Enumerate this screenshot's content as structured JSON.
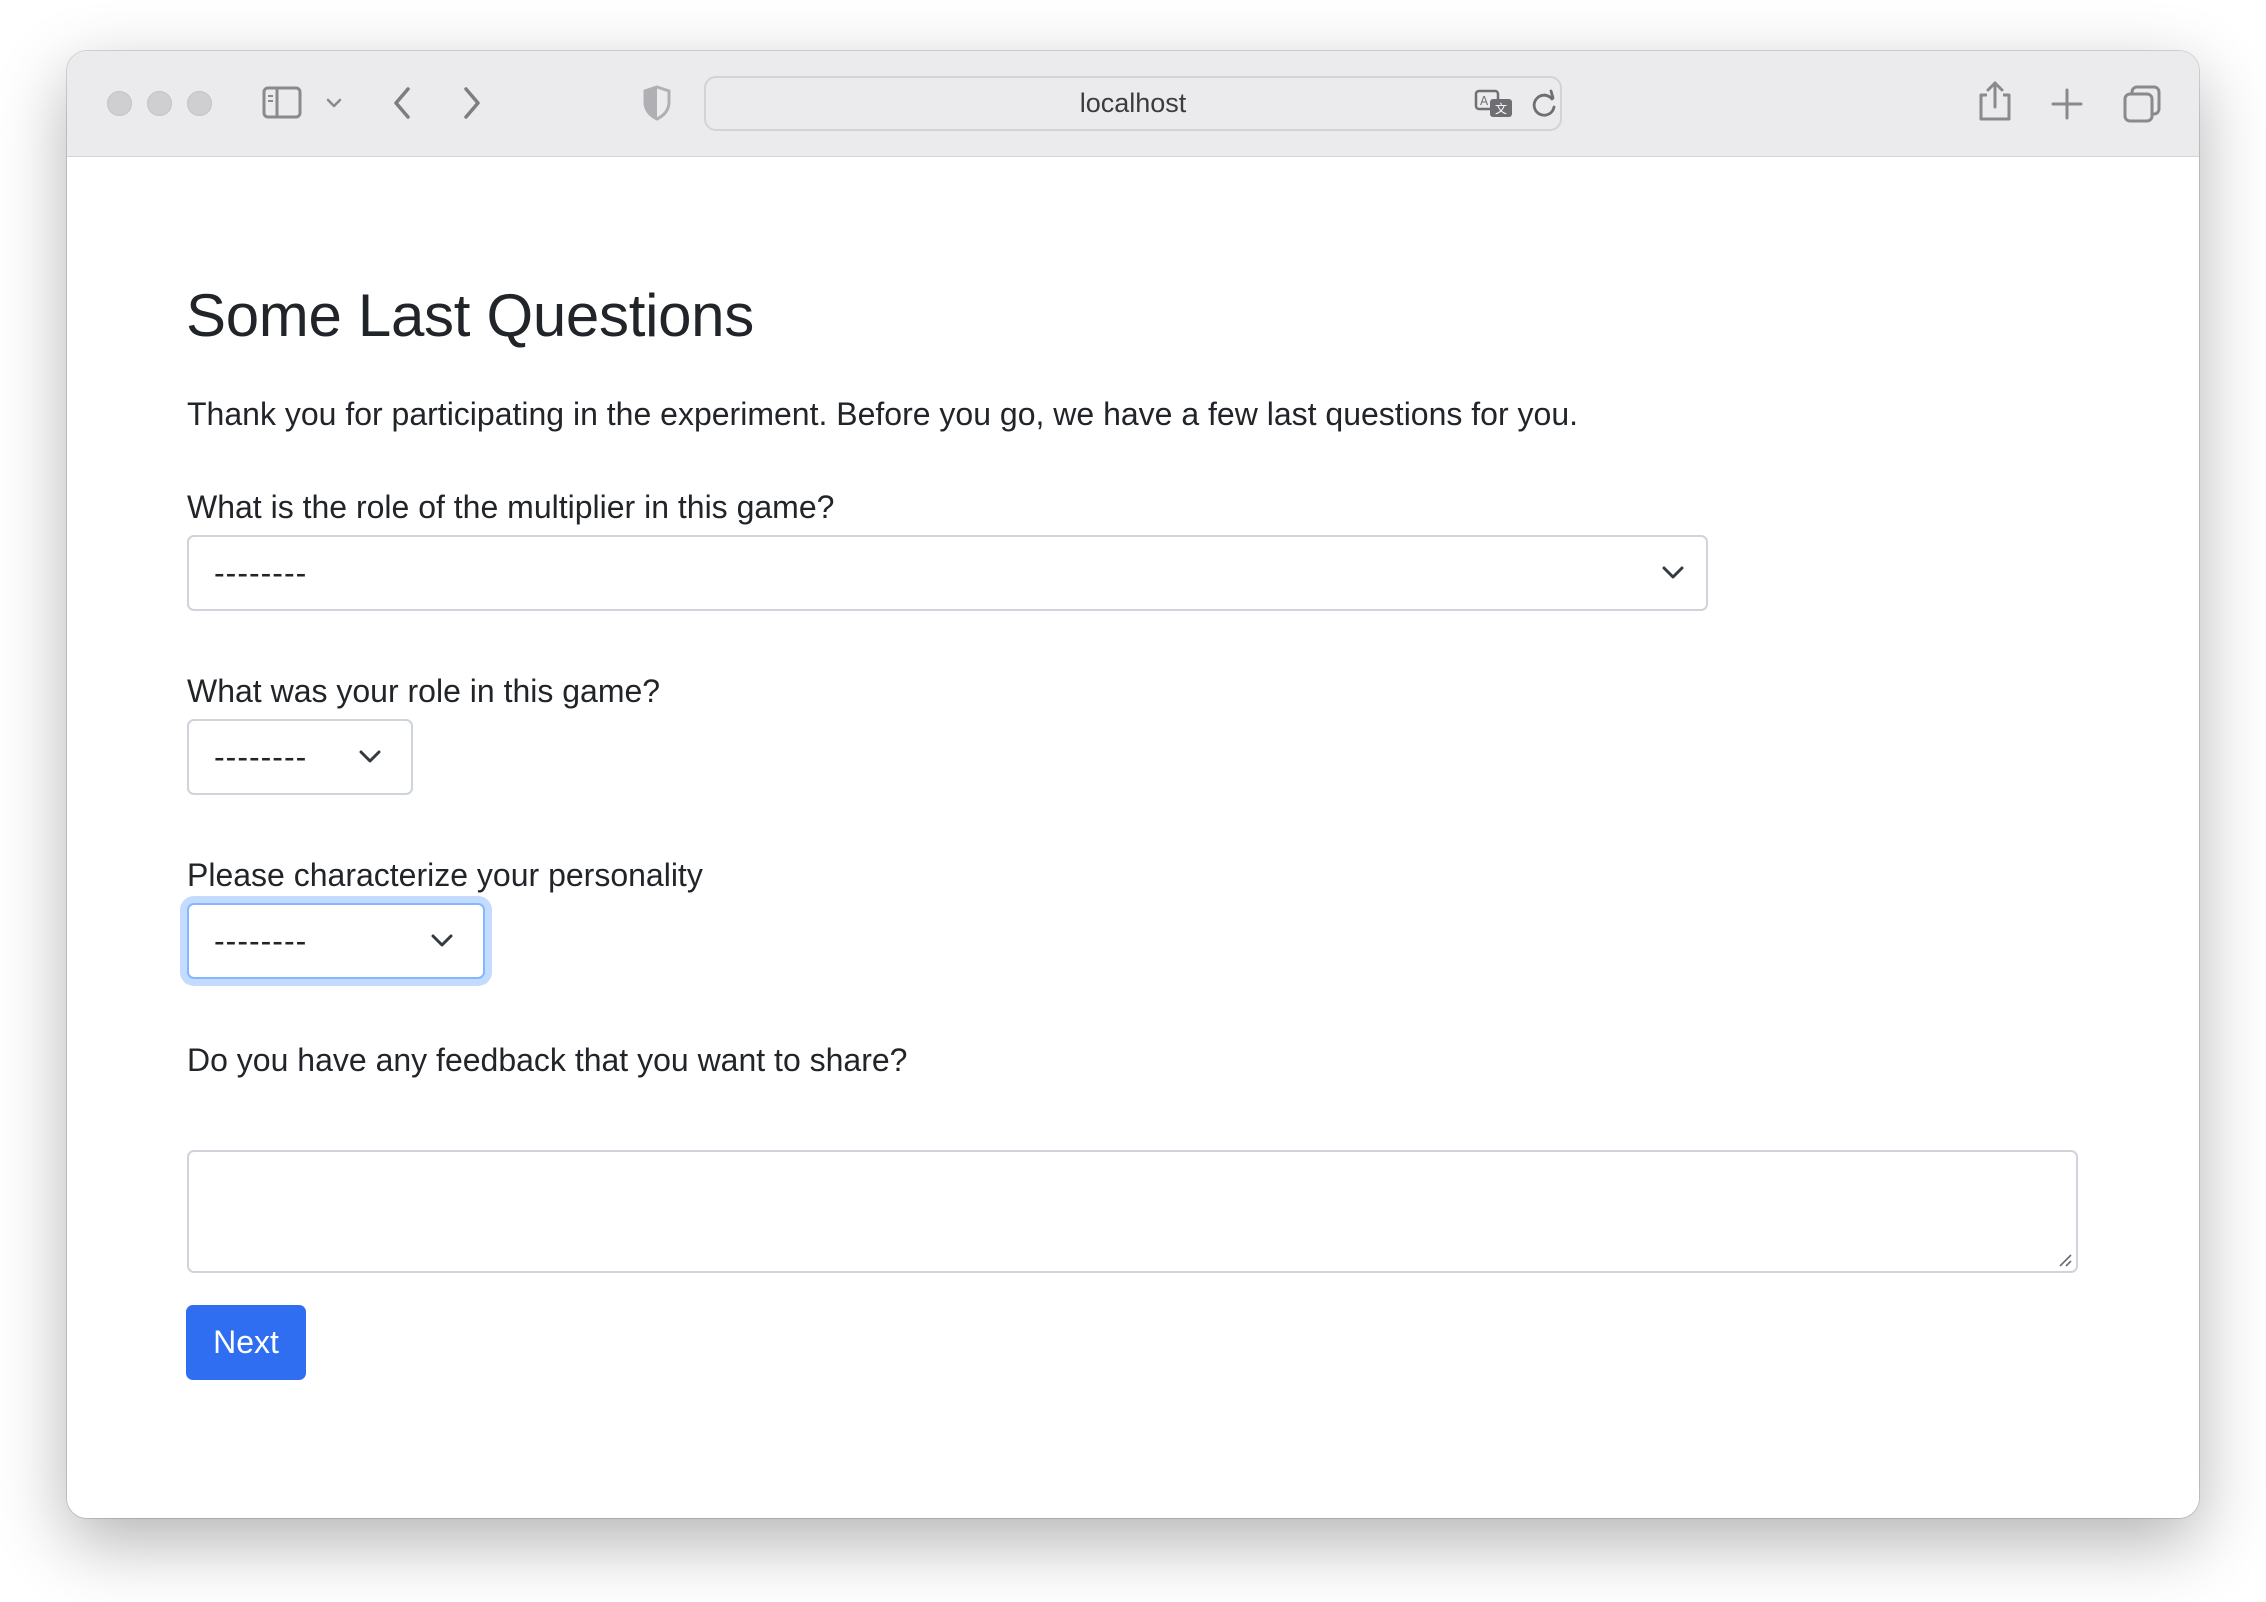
{
  "browser": {
    "address": "localhost",
    "icons": [
      "close-light",
      "minimize-light",
      "zoom-light",
      "sidebar-icon",
      "chevron-down-icon",
      "back-icon",
      "forward-icon",
      "privacy-shield-icon",
      "translate-icon",
      "reload-icon",
      "share-icon",
      "new-tab-icon",
      "tab-overview-icon"
    ]
  },
  "page": {
    "title": "Some Last Questions",
    "intro": "Thank you for participating in the experiment. Before you go, we have a few last questions for you."
  },
  "form": {
    "q1": {
      "label": "What is the role of the multiplier in this game?",
      "value": "--------"
    },
    "q2": {
      "label": "What was your role in this game?",
      "value": "--------"
    },
    "q3": {
      "label": "Please characterize your personality",
      "value": "--------"
    },
    "q4": {
      "label": "Do you have any feedback that you want to share?",
      "value": ""
    },
    "submit_label": "Next"
  },
  "colors": {
    "primary": "#2f6ef0",
    "focus_ring": "#86b7fe",
    "text": "#212529"
  }
}
